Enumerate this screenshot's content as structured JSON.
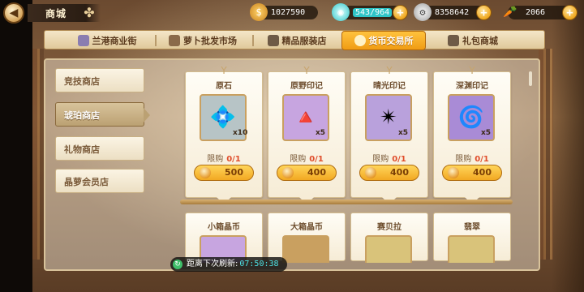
{
  "header": {
    "title": "商城",
    "back_icon": "back-arrow-icon"
  },
  "resources": [
    {
      "icon": "gold-coin-bag-icon",
      "value": "1027590",
      "has_plus": false,
      "color": "#e9a83a"
    },
    {
      "icon": "stamina-orb-icon",
      "value": "543/964",
      "has_plus": true,
      "highlight": true,
      "color": "#2fc5c7"
    },
    {
      "icon": "silver-gear-coin-icon",
      "value": "8358642",
      "has_plus": true,
      "color": "#c9c9c9"
    },
    {
      "icon": "carrot-icon",
      "value": "2066",
      "has_plus": true,
      "color": "#f07a1f"
    }
  ],
  "tabs": [
    {
      "label": "兰港商业街",
      "icon": "gem-icon",
      "active": false
    },
    {
      "label": "萝卜批发市场",
      "icon": "carrot-icon",
      "active": false
    },
    {
      "label": "精品服装店",
      "icon": "dress-icon",
      "active": false
    },
    {
      "label": "货币交易所",
      "icon": "coin-icon",
      "active": true
    },
    {
      "label": "礼包商城",
      "icon": "gift-box-icon",
      "active": false
    }
  ],
  "side_menu": [
    {
      "label": "竞技商店",
      "active": false
    },
    {
      "label": "琥珀商店",
      "active": true
    },
    {
      "label": "礼物商店",
      "active": false
    },
    {
      "label": "晶萝会员店",
      "active": false
    }
  ],
  "items_row1": [
    {
      "name": "原石",
      "qty": "x10",
      "limit_label": "限购",
      "limit_value": "0/1",
      "price": "500",
      "icon": "raw-stone-icon",
      "bg": "#b7c4c6"
    },
    {
      "name": "原野印记",
      "qty": "x5",
      "limit_label": "限购",
      "limit_value": "0/1",
      "price": "400",
      "icon": "wild-seal-icon",
      "bg": "#c7a5e0"
    },
    {
      "name": "晴光印记",
      "qty": "x5",
      "limit_label": "限购",
      "limit_value": "0/1",
      "price": "400",
      "icon": "sun-seal-icon",
      "bg": "#b9a1dc"
    },
    {
      "name": "深渊印记",
      "qty": "x5",
      "limit_label": "限购",
      "limit_value": "0/1",
      "price": "400",
      "icon": "abyss-seal-icon",
      "bg": "#a98bd6"
    }
  ],
  "items_row2": [
    {
      "name": "小箱晶币",
      "bg": "#c7a5e0"
    },
    {
      "name": "大箱晶币",
      "bg": "#c9a060"
    },
    {
      "name": "赛贝拉",
      "bg": "#d9c37a"
    },
    {
      "name": "翡翠",
      "bg": "#d9c37a"
    }
  ],
  "refresh": {
    "label": "距离下次刷新:",
    "time": "07:50:38",
    "icon": "refresh-icon"
  }
}
